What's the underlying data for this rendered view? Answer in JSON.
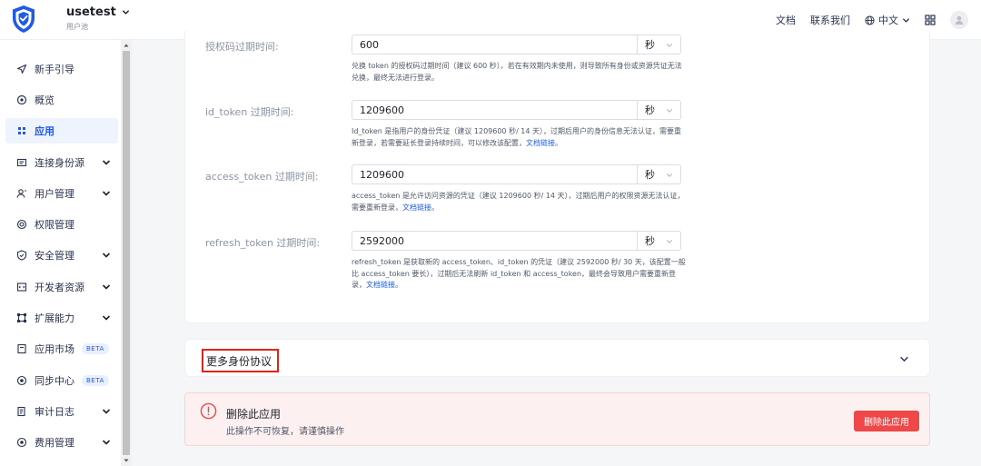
{
  "header": {
    "app_name": "usetest",
    "app_sub": "用户池",
    "docs": "文档",
    "contact": "联系我们",
    "language": "中文"
  },
  "sidebar": {
    "items": [
      {
        "label": "新手引导",
        "icon": "send-icon"
      },
      {
        "label": "概览",
        "icon": "dashboard-icon"
      },
      {
        "label": "应用",
        "icon": "apps-grid-icon",
        "active": true
      },
      {
        "label": "连接身份源",
        "icon": "identity-source-icon",
        "expandable": true
      },
      {
        "label": "用户管理",
        "icon": "user-icon",
        "expandable": true
      },
      {
        "label": "权限管理",
        "icon": "permission-icon"
      },
      {
        "label": "安全管理",
        "icon": "shield-icon",
        "expandable": true
      },
      {
        "label": "开发者资源",
        "icon": "code-icon",
        "expandable": true
      },
      {
        "label": "扩展能力",
        "icon": "extension-icon",
        "expandable": true
      },
      {
        "label": "应用市场",
        "icon": "market-icon",
        "badge": "BETA"
      },
      {
        "label": "同步中心",
        "icon": "sync-icon",
        "badge": "BETA"
      },
      {
        "label": "审计日志",
        "icon": "log-icon",
        "expandable": true
      },
      {
        "label": "费用管理",
        "icon": "billing-icon",
        "expandable": true
      }
    ]
  },
  "token_settings": {
    "fields": [
      {
        "label": "授权码过期时间:",
        "value": "600",
        "unit": "秒",
        "help": "兑换 token 的授权码过期时间（建议 600 秒），若在有效期内未使用，则导致所有身份或资源凭证无法兑换，最终无法进行登录。",
        "link": ""
      },
      {
        "label": "id_token 过期时间:",
        "value": "1209600",
        "unit": "秒",
        "help": "Id_token 是指用户的身份凭证（建议 1209600 秒/ 14 天），过期后用户的身份信息无法认证，需要重新登录，若需要延长登录持续时间，可以修改该配置，",
        "link": "文档链接。"
      },
      {
        "label": "access_token 过期时间:",
        "value": "1209600",
        "unit": "秒",
        "help": "access_token 是允许访问资源的凭证（建议 1209600 秒/ 14 天），过期后用户的权限资源无法认证，需要重新登录，",
        "link": "文档链接。"
      },
      {
        "label": "refresh_token 过期时间:",
        "value": "2592000",
        "unit": "秒",
        "help": "refresh_token 是获取新的 access_token、id_token 的凭证（建议 2592000 秒/ 30 天，该配置一般比 access_token 要长），过期后无法刷新 id_token 和 access_token，最终会导致用户需要重新登录，",
        "link": "文档链接。"
      }
    ]
  },
  "more_protocols": {
    "title": "更多身份协议"
  },
  "danger_zone": {
    "title": "删除此应用",
    "description": "此操作不可恢复，请谨慎操作",
    "button": "删除此应用"
  },
  "colors": {
    "primary": "#215ae5",
    "danger": "#ef4848",
    "highlight_border": "#e2231a"
  }
}
